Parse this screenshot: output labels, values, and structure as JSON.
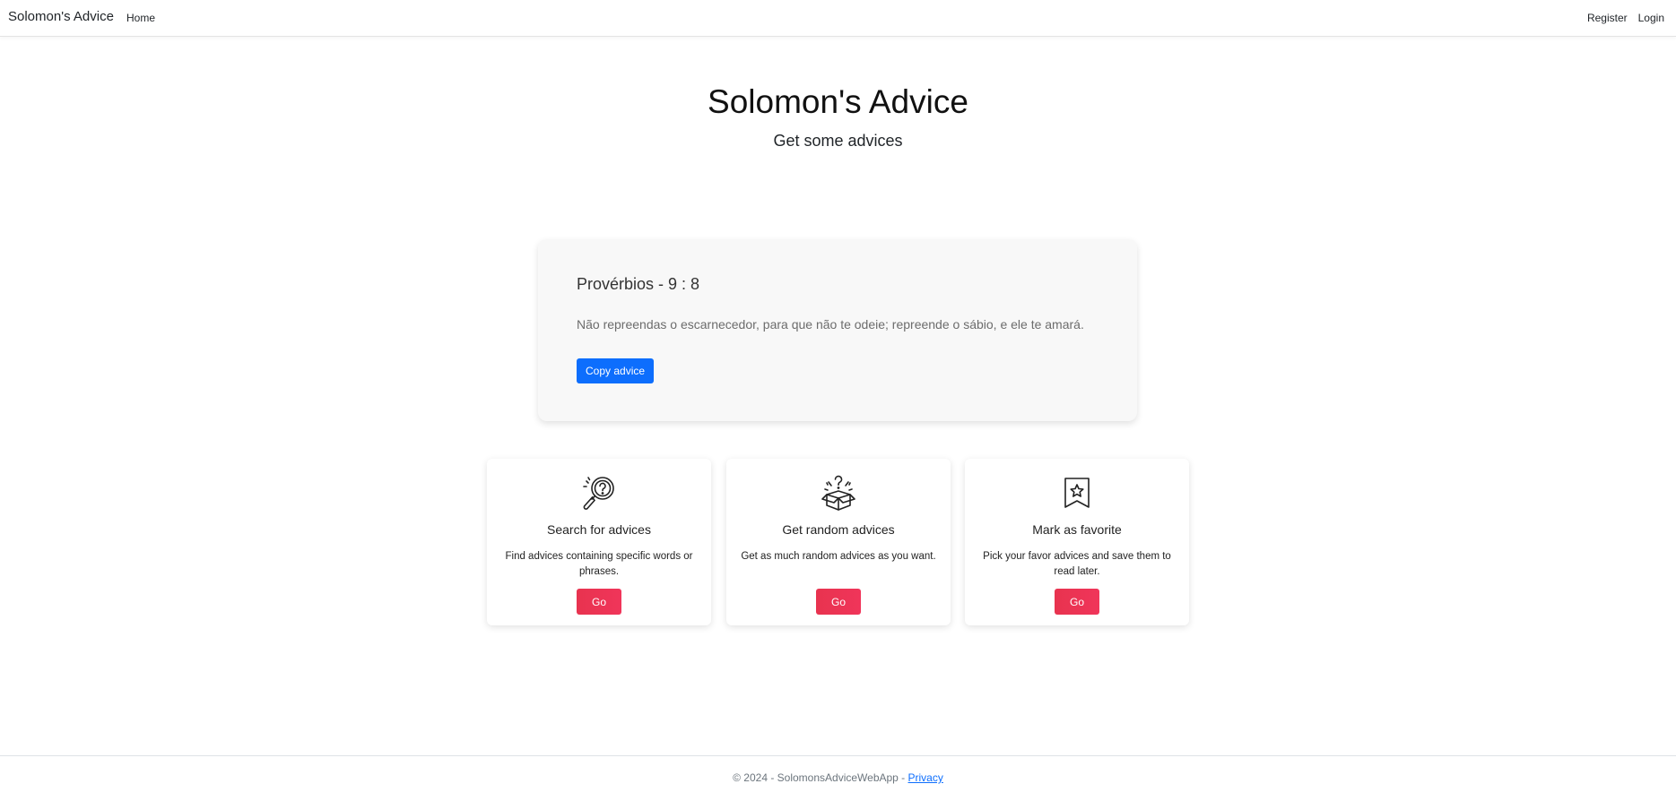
{
  "navbar": {
    "brand": "Solomon's Advice",
    "home": "Home",
    "register": "Register",
    "login": "Login"
  },
  "hero": {
    "title": "Solomon's Advice",
    "subtitle": "Get some advices"
  },
  "advice": {
    "reference": "Provérbios - 9 : 8",
    "text": "Não repreendas o escarnecedor, para que não te odeie; repreende o sábio, e ele te amará.",
    "copy_label": "Copy advice"
  },
  "features": [
    {
      "icon": "search-question-icon",
      "title": "Search for advices",
      "description": "Find advices containing specific words or phrases.",
      "button": "Go"
    },
    {
      "icon": "surprise-box-icon",
      "title": "Get random advices",
      "description": "Get as much random advices as you want.",
      "button": "Go"
    },
    {
      "icon": "bookmark-star-icon",
      "title": "Mark as favorite",
      "description": "Pick your favor advices and save them to read later.",
      "button": "Go"
    }
  ],
  "footer": {
    "copyright": "© 2024 - SolomonsAdviceWebApp - ",
    "privacy": "Privacy"
  },
  "colors": {
    "primary_button": "#0d6efd",
    "go_button": "#ee3456",
    "card_background": "#f8f8f8"
  }
}
